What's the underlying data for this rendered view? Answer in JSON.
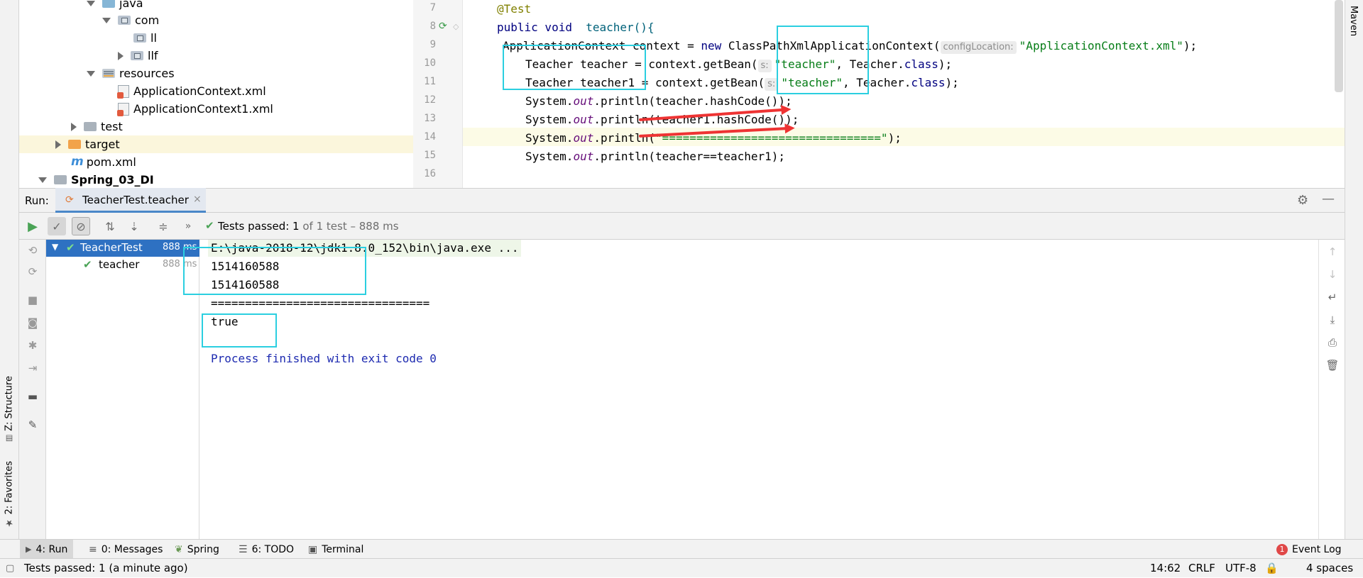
{
  "left_strip": {
    "structure_tab": "Z: Structure",
    "favorites_tab": "2: Favorites"
  },
  "right_strip": {
    "maven_tab": "Maven"
  },
  "project_tree": {
    "java": "java",
    "com": "com",
    "ll": "ll",
    "llf": "llf",
    "resources": "resources",
    "app_ctx": "ApplicationContext.xml",
    "app_ctx1": "ApplicationContext1.xml",
    "test": "test",
    "target": "target",
    "pom": "pom.xml",
    "module": "Spring_03_DI"
  },
  "editor": {
    "line_numbers": [
      "7",
      "8",
      "9",
      "10",
      "11",
      "12",
      "13",
      "14",
      "15",
      "16"
    ],
    "l7": "@Test",
    "l8_kw": "public void",
    "l8_rest": "teacher(){",
    "l9_a": "ApplicationContext context = ",
    "l9_new": "new",
    "l9_b": " ClassPathXmlApplicationContext(",
    "l9_hint": "configLocation:",
    "l9_str": "\"ApplicationContext.xml\"",
    "l9_end": ");",
    "l10_a": "Teacher teacher = context.getBean(",
    "l10_hint": "s:",
    "l10_str": "\"teacher\"",
    "l10_b": ", Teacher.",
    "l10_cls": "class",
    "l10_end": ");",
    "l11_a": "Teacher teacher1 = context.getBean(",
    "l11_hint": "s:",
    "l11_str": "\"teacher\"",
    "l11_b": ", Teacher.",
    "l11_cls": "class",
    "l11_end": ");",
    "sys": "System.",
    "out": "out",
    "l12_rest": ".println(teacher.hashCode());",
    "l13_rest": ".println(teacher1.hashCode());",
    "l14_a": ".println(",
    "l14_str": "\"================================\"",
    "l14_end": ");",
    "l15_rest": ".println(teacher==teacher1);"
  },
  "run": {
    "label": "Run:",
    "tab_title": "TeacherTest.teacher",
    "tests_passed_bold": "Tests passed: 1",
    "tests_passed_rest": "of 1 test – 888 ms",
    "tree": [
      {
        "name": "TeacherTest",
        "time": "888 ms"
      },
      {
        "name": "teacher",
        "time": "888 ms"
      }
    ],
    "console": {
      "cmd": "E:\\java-2018-12\\jdk1.8.0_152\\bin\\java.exe ...",
      "hash1": "1514160588",
      "hash2": "1514160588",
      "separator": "================================",
      "result": "true",
      "exit": "Process finished with exit code 0"
    }
  },
  "bottom_tabs": {
    "run": "4: Run",
    "messages": "0: Messages",
    "spring": "Spring",
    "todo": "6: TODO",
    "terminal": "Terminal",
    "event_log": "Event Log",
    "event_badge": "1"
  },
  "status": {
    "message": "Tests passed: 1 (a minute ago)",
    "position": "14:62",
    "line_sep": "CRLF",
    "encoding": "UTF-8",
    "indent": "4 spaces"
  },
  "colors": {
    "annotation_box": "#2bcfe0",
    "annotation_arrow": "#ee3333",
    "selection": "#2e71c2",
    "pass_green": "#4aa356"
  }
}
